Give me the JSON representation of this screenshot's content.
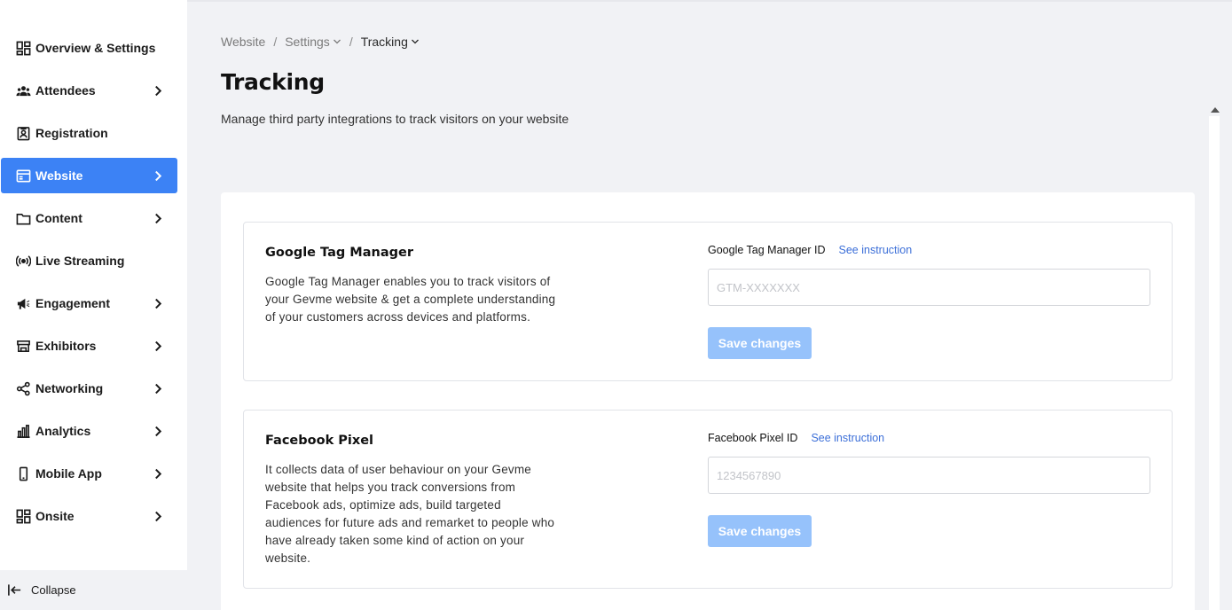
{
  "sidebar": {
    "items": [
      {
        "label": "Overview & Settings",
        "icon": "dashboard-icon",
        "has_chevron": false,
        "active": false
      },
      {
        "label": "Attendees",
        "icon": "people-icon",
        "has_chevron": true,
        "active": false
      },
      {
        "label": "Registration",
        "icon": "id-badge-icon",
        "has_chevron": false,
        "active": false
      },
      {
        "label": "Website",
        "icon": "browser-window-icon",
        "has_chevron": true,
        "active": true
      },
      {
        "label": "Content",
        "icon": "folder-icon",
        "has_chevron": true,
        "active": false
      },
      {
        "label": "Live Streaming",
        "icon": "broadcast-icon",
        "has_chevron": false,
        "active": false
      },
      {
        "label": "Engagement",
        "icon": "megaphone-icon",
        "has_chevron": true,
        "active": false
      },
      {
        "label": "Exhibitors",
        "icon": "storefront-icon",
        "has_chevron": true,
        "active": false
      },
      {
        "label": "Networking",
        "icon": "share-nodes-icon",
        "has_chevron": true,
        "active": false
      },
      {
        "label": "Analytics",
        "icon": "bar-chart-icon",
        "has_chevron": true,
        "active": false
      },
      {
        "label": "Mobile App",
        "icon": "mobile-phone-icon",
        "has_chevron": true,
        "active": false
      },
      {
        "label": "Onsite",
        "icon": "grid-icon",
        "has_chevron": true,
        "active": false
      }
    ],
    "collapse_label": "Collapse"
  },
  "breadcrumb": {
    "items": [
      "Website",
      "Settings",
      "Tracking"
    ],
    "separator": "/"
  },
  "page": {
    "title": "Tracking",
    "subtitle": "Manage third party integrations to track visitors on your website"
  },
  "cards": [
    {
      "title": "Google Tag Manager",
      "description": "Google Tag Manager enables you to track visitors of your Gevme website & get a complete understanding of your customers across devices and platforms.",
      "field_label": "Google Tag Manager ID",
      "link_label": "See instruction",
      "placeholder": "GTM-XXXXXXX",
      "value": "",
      "button_label": "Save changes"
    },
    {
      "title": "Facebook Pixel",
      "description": "It collects data of user behaviour on your Gevme website that helps you track conversions from Facebook ads, optimize ads, build targeted audiences for future ads and remarket to people who have already taken some kind of action on your website.",
      "field_label": "Facebook Pixel ID",
      "link_label": "See instruction",
      "placeholder": "1234567890",
      "value": "",
      "button_label": "Save changes"
    }
  ],
  "colors": {
    "accent": "#3c82f5",
    "button_disabled": "#96c2fb",
    "link": "#3c6fd8",
    "background": "#f1f2f5"
  }
}
